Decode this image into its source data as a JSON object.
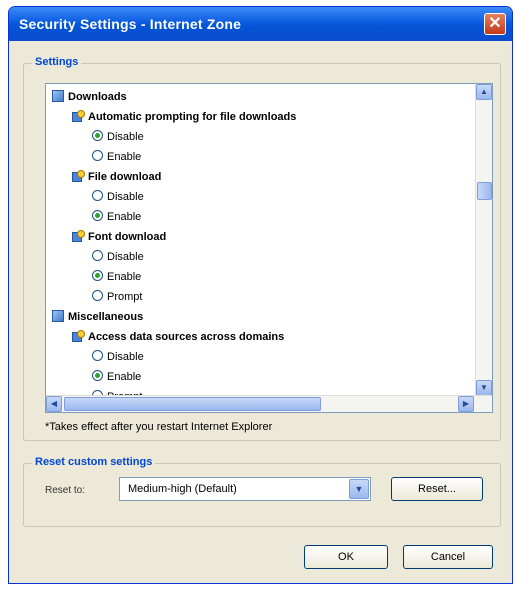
{
  "window": {
    "title": "Security Settings - Internet Zone",
    "close_glyph": "✕"
  },
  "settings_group": {
    "label": "Settings"
  },
  "tree": [
    {
      "kind": "category",
      "label": "Downloads",
      "icon": "downloads-category-icon"
    },
    {
      "kind": "setting",
      "label": "Automatic prompting for file downloads",
      "icon": "setting-icon"
    },
    {
      "kind": "option",
      "label": "Disable",
      "checked": true
    },
    {
      "kind": "option",
      "label": "Enable",
      "checked": false
    },
    {
      "kind": "setting",
      "label": "File download",
      "icon": "setting-icon"
    },
    {
      "kind": "option",
      "label": "Disable",
      "checked": false
    },
    {
      "kind": "option",
      "label": "Enable",
      "checked": true
    },
    {
      "kind": "setting",
      "label": "Font download",
      "icon": "setting-icon"
    },
    {
      "kind": "option",
      "label": "Disable",
      "checked": false
    },
    {
      "kind": "option",
      "label": "Enable",
      "checked": true
    },
    {
      "kind": "option",
      "label": "Prompt",
      "checked": false
    },
    {
      "kind": "category",
      "label": "Miscellaneous",
      "icon": "miscellaneous-category-icon"
    },
    {
      "kind": "setting",
      "label": "Access data sources across domains",
      "icon": "setting-icon"
    },
    {
      "kind": "option",
      "label": "Disable",
      "checked": false
    },
    {
      "kind": "option",
      "label": "Enable",
      "checked": true
    },
    {
      "kind": "option",
      "label": "Prompt",
      "checked": false
    }
  ],
  "note": "*Takes effect after you restart Internet Explorer",
  "reset_group": {
    "label": "Reset custom settings",
    "reset_to_label": "Reset to:",
    "selected": "Medium-high (Default)",
    "reset_button": "Reset..."
  },
  "buttons": {
    "ok": "OK",
    "cancel": "Cancel"
  },
  "scroll": {
    "up": "▲",
    "down": "▼",
    "left": "◀",
    "right": "▶"
  },
  "colors": {
    "title_bar": "#0a5be0",
    "group_label": "#0046d5",
    "radio_checked": "#2aa52a"
  }
}
